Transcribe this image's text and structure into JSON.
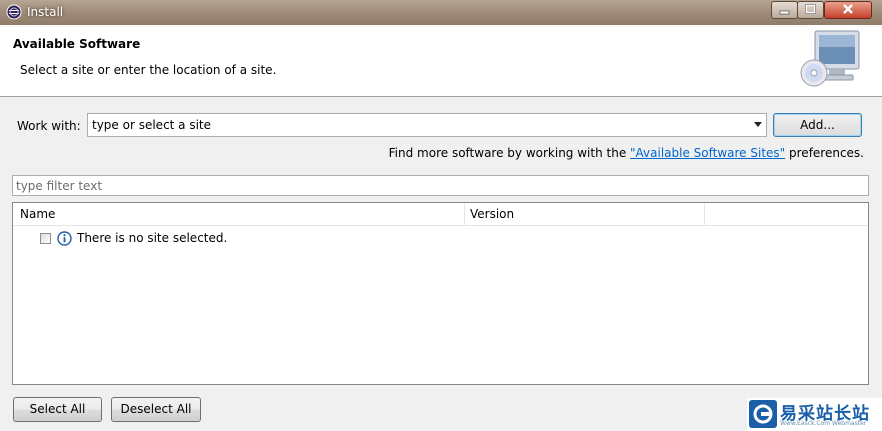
{
  "window": {
    "title": "Install"
  },
  "banner": {
    "title": "Available Software",
    "subtitle": "Select a site or enter the location of a site."
  },
  "work_with": {
    "label": "Work with:",
    "value": "type or select a site",
    "add_label": "Add..."
  },
  "find_more": {
    "prefix": "Find more software by working with the ",
    "link": "\"Available Software Sites\"",
    "suffix": " preferences."
  },
  "filter": {
    "placeholder": "type filter text"
  },
  "table": {
    "columns": [
      "Name",
      "Version"
    ],
    "rows": [
      {
        "text": "There is no site selected.",
        "checked": false,
        "icon": "info-icon"
      }
    ]
  },
  "buttons": {
    "select_all": "Select All",
    "deselect_all": "Deselect All"
  },
  "watermark": {
    "text": "易采站长站",
    "sub": "Www.Easck.Com Webmaster"
  },
  "colors": {
    "link": "#0066cc",
    "titlebar": "#a08d7a",
    "watermark": "#1a5fa8"
  }
}
